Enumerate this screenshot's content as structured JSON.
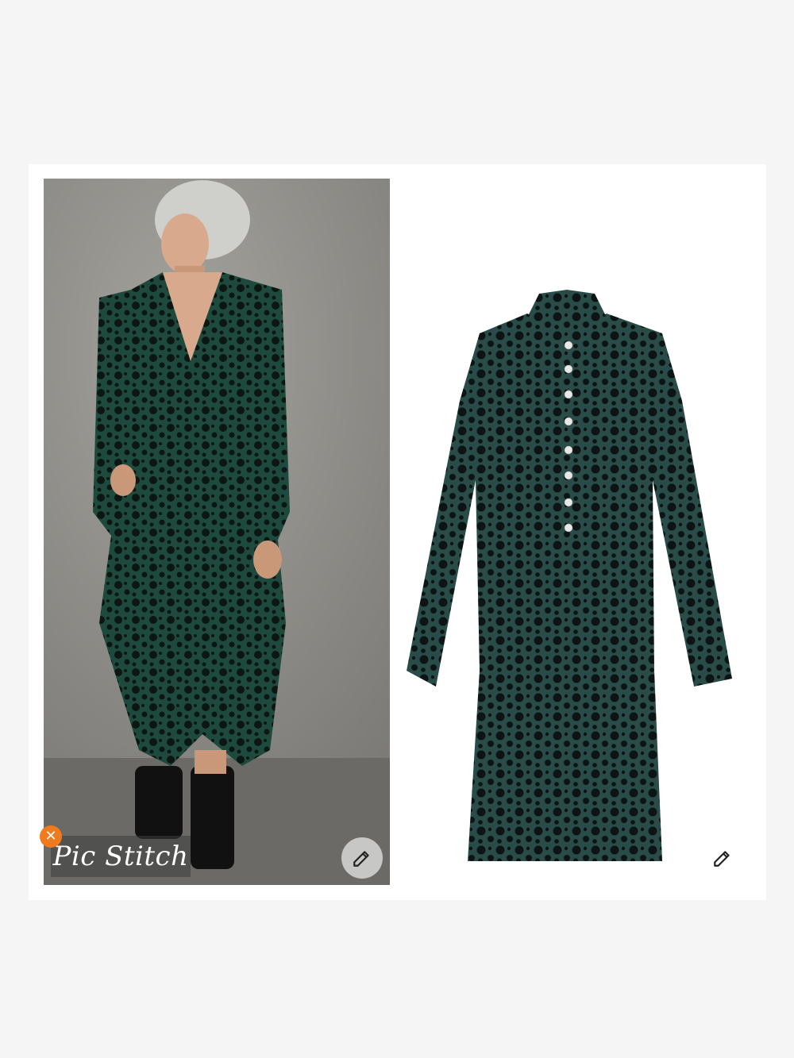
{
  "watermark": {
    "text": "Pic Stitch"
  },
  "colors": {
    "background": "#f5f5f5",
    "card": "#ffffff",
    "fabric_green": "#1f4a3f",
    "dot_black": "#0d1512",
    "badge_orange": "#f07a1c"
  },
  "left_panel": {
    "content": "model-wearing-polka-dot-velvet-jumpsuit"
  },
  "right_panel": {
    "content": "polka-dot-velvet-shirt-dress"
  },
  "icons": {
    "close": "close-icon",
    "edit": "pencil-icon"
  }
}
